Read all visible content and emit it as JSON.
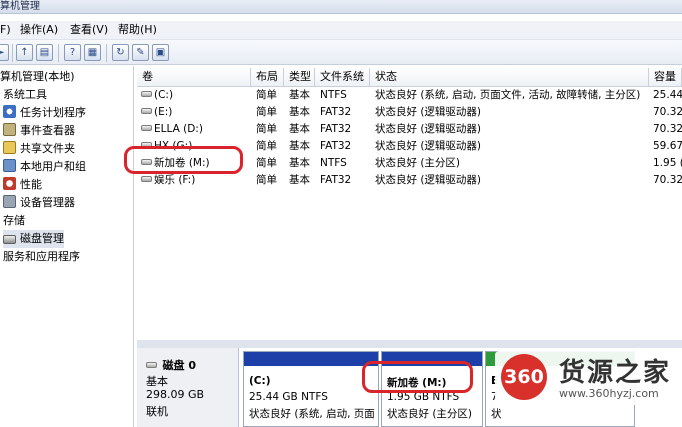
{
  "window": {
    "title": "算机管理"
  },
  "menu": [
    "F)",
    "操作(A)",
    "查看(V)",
    "帮助(H)"
  ],
  "toolbar_icons": [
    "back-icon",
    "forward-icon",
    "up-folder-icon",
    "show-tree-icon",
    "help-icon",
    "properties-view-icon",
    "refresh-icon",
    "settings-icon",
    "export-icon"
  ],
  "tree": {
    "root": "算机管理(本地)",
    "system_tools": "系统工具",
    "task_scheduler": "任务计划程序",
    "event_viewer": "事件查看器",
    "shared_folders": "共享文件夹",
    "local_users": "本地用户和组",
    "performance": "性能",
    "device_manager": "设备管理器",
    "storage": "存储",
    "disk_management": "磁盘管理",
    "services": "服务和应用程序"
  },
  "columns": [
    "卷",
    "布局",
    "类型",
    "文件系统",
    "状态",
    "容量"
  ],
  "volumes": [
    {
      "name": "(C:)",
      "layout": "简单",
      "type": "基本",
      "fs": "NTFS",
      "status": "状态良好 (系统, 启动, 页面文件, 活动, 故障转储, 主分区)",
      "capacity": "25.44"
    },
    {
      "name": "(E:)",
      "layout": "简单",
      "type": "基本",
      "fs": "FAT32",
      "status": "状态良好 (逻辑驱动器)",
      "capacity": "70.32"
    },
    {
      "name": "ELLA (D:)",
      "layout": "简单",
      "type": "基本",
      "fs": "FAT32",
      "status": "状态良好 (逻辑驱动器)",
      "capacity": "70.32"
    },
    {
      "name": "HX (G:)",
      "layout": "简单",
      "type": "基本",
      "fs": "FAT32",
      "status": "状态良好 (逻辑驱动器)",
      "capacity": "59.67"
    },
    {
      "name": "新加卷 (M:)",
      "layout": "简单",
      "type": "基本",
      "fs": "NTFS",
      "status": "状态良好 (主分区)",
      "capacity": "1.95 ("
    },
    {
      "name": "娱乐 (F:)",
      "layout": "简单",
      "type": "基本",
      "fs": "FAT32",
      "status": "状态良好 (逻辑驱动器)",
      "capacity": "70.32"
    }
  ],
  "disk": {
    "name": "磁盘 0",
    "type": "基本",
    "size": "298.09 GB",
    "status": "联机",
    "partitions": [
      {
        "name": "(C:)",
        "size": "25.44 GB NTFS",
        "status": "状态良好 (系统, 启动, 页面"
      },
      {
        "name": "新加卷 (M:)",
        "size": "1.95 GB NTFS",
        "status": "状态良好 (主分区)"
      },
      {
        "name": "E",
        "size": "7",
        "status": "状"
      }
    ]
  },
  "watermark": {
    "badge": "360",
    "name": "货源之家",
    "url": "www.360hyzj.com"
  },
  "colors": {
    "partition_bar": "#1d3fa8",
    "annotation": "#d8242a",
    "badge": "#d8302a"
  }
}
